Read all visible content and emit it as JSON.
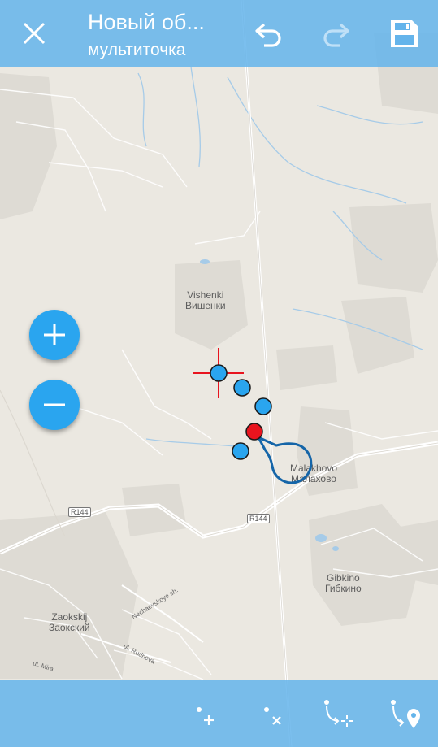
{
  "header": {
    "title": "Новый об...",
    "subtitle": "мультиточка"
  },
  "toolbar": {
    "close_icon": "close-icon",
    "undo_icon": "undo-icon",
    "redo_icon": "redo-icon",
    "save_icon": "save-icon"
  },
  "map": {
    "places": [
      {
        "latin": "Vishenki",
        "cyrillic": "Вишенки"
      },
      {
        "latin": "Malakhovo",
        "cyrillic": "Малахово"
      },
      {
        "latin": "Gibkino",
        "cyrillic": "Гибкино"
      },
      {
        "latin": "Zaokskij",
        "cyrillic": "Заокский"
      }
    ],
    "road_shields": [
      "R144",
      "R144"
    ],
    "streets": [
      "Nechaevskoye sh.",
      "ul. Rudneva",
      "ul. Mira"
    ]
  },
  "zoom": {
    "zoom_in_icon": "plus-icon",
    "zoom_out_icon": "minus-icon"
  },
  "bottom_actions": {
    "add_point_icon": "add-point-icon",
    "delete_point_icon": "delete-point-icon",
    "add_point_at_center_icon": "add-point-center-icon",
    "add_point_by_location_icon": "add-point-location-icon"
  },
  "colors": {
    "bar": "#64b4eb",
    "point": "#2aa5ef",
    "selected_point": "#e8141e",
    "crosshair": "#e8141e",
    "callout": "#1565a8"
  }
}
